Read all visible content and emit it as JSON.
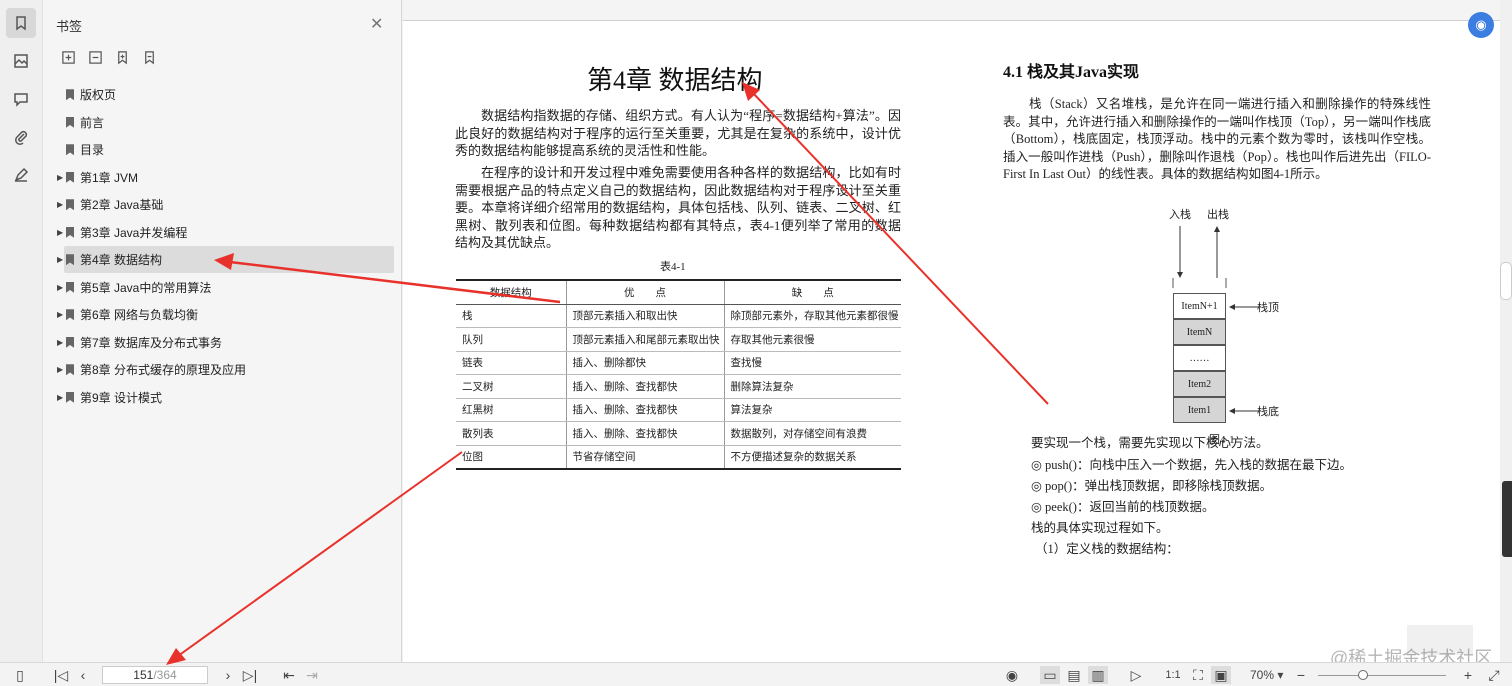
{
  "bookmarks": {
    "title": "书签",
    "items": [
      {
        "label": "版权页",
        "expandable": false
      },
      {
        "label": "前言",
        "expandable": false
      },
      {
        "label": "目录",
        "expandable": false
      },
      {
        "label": "第1章 JVM",
        "expandable": true
      },
      {
        "label": "第2章 Java基础",
        "expandable": true
      },
      {
        "label": "第3章 Java并发编程",
        "expandable": true
      },
      {
        "label": "第4章 数据结构",
        "expandable": true,
        "selected": true
      },
      {
        "label": "第5章 Java中的常用算法",
        "expandable": true
      },
      {
        "label": "第6章 网络与负载均衡",
        "expandable": true
      },
      {
        "label": "第7章 数据库及分布式事务",
        "expandable": true
      },
      {
        "label": "第8章 分布式缓存的原理及应用",
        "expandable": true
      },
      {
        "label": "第9章 设计模式",
        "expandable": true
      }
    ]
  },
  "left_page": {
    "chapter_title": "第4章  数据结构",
    "para1": "数据结构指数据的存储、组织方式。有人认为“程序=数据结构+算法”。因此良好的数据结构对于程序的运行至关重要，尤其是在复杂的系统中，设计优秀的数据结构能够提高系统的灵活性和性能。",
    "para2": "在程序的设计和开发过程中难免需要使用各种各样的数据结构，比如有时需要根据产品的特点定义自己的数据结构，因此数据结构对于程序设计至关重要。本章将详细介绍常用的数据结构，具体包括栈、队列、链表、二叉树、红黑树、散列表和位图。每种数据结构都有其特点，表4-1便列举了常用的数据结构及其优缺点。",
    "table_caption": "表4-1",
    "table_headers": [
      "数据结构",
      "优　　点",
      "缺　　点"
    ],
    "table_rows": [
      [
        "栈",
        "顶部元素插入和取出快",
        "除顶部元素外，存取其他元素都很慢"
      ],
      [
        "队列",
        "顶部元素插入和尾部元素取出快",
        "存取其他元素很慢"
      ],
      [
        "链表",
        "插入、删除都快",
        "查找慢"
      ],
      [
        "二叉树",
        "插入、删除、查找都快",
        "删除算法复杂"
      ],
      [
        "红黑树",
        "插入、删除、查找都快",
        "算法复杂"
      ],
      [
        "散列表",
        "插入、删除、查找都快",
        "数据散列，对存储空间有浪费"
      ],
      [
        "位图",
        "节省存储空间",
        "不方便描述复杂的数据关系"
      ]
    ]
  },
  "right_page": {
    "section_title": "4.1  栈及其Java实现",
    "para": "栈（Stack）又名堆栈，是允许在同一端进行插入和删除操作的特殊线性表。其中，允许进行插入和删除操作的一端叫作栈顶（Top），另一端叫作栈底（Bottom），栈底固定，栈顶浮动。栈中的元素个数为零时，该栈叫作空栈。插入一般叫作进栈（Push），删除叫作退栈（Pop）。栈也叫作后进先出（FILO-First In Last Out）的线性表。具体的数据结构如图4-1所示。",
    "figure": {
      "push_label": "入栈",
      "pop_label": "出栈",
      "top_label": "栈顶",
      "bottom_label": "栈底",
      "cells": [
        "ItemN+1",
        "ItemN",
        "……",
        "Item2",
        "Item1"
      ],
      "caption": "图4-1"
    },
    "lines": [
      "要实现一个栈，需要先实现以下核心方法。",
      "◎ push()：向栈中压入一个数据，先入栈的数据在最下边。",
      "◎ pop()：弹出栈顶数据，即移除栈顶数据。",
      "◎ peek()：返回当前的栈顶数据。",
      "栈的具体实现过程如下。",
      "（1）定义栈的数据结构："
    ]
  },
  "statusbar": {
    "current_page": "151",
    "total_pages": "/364",
    "zoom": "70%"
  },
  "watermark": "@稀土掘金技术社区",
  "annotation_color": "#e8312a"
}
